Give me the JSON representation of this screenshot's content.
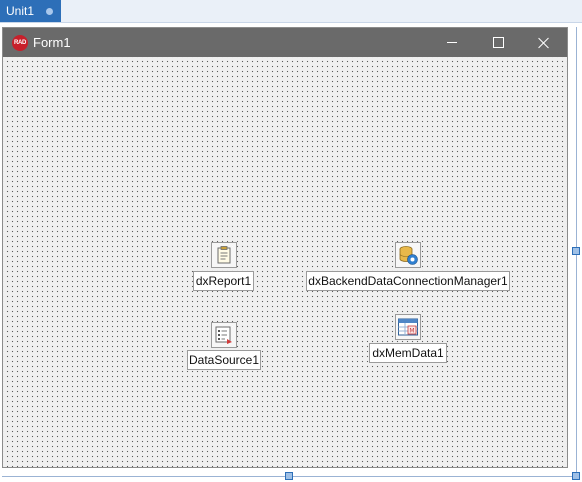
{
  "tab": {
    "label": "Unit1"
  },
  "form": {
    "title": "Form1",
    "icon_text": "RAD"
  },
  "components": [
    {
      "name": "dxReport1",
      "icon": "report-icon"
    },
    {
      "name": "dxBackendDataConnectionManager1",
      "icon": "database-gear-icon"
    },
    {
      "name": "DataSource1",
      "icon": "datasource-icon"
    },
    {
      "name": "dxMemData1",
      "icon": "memdata-table-icon"
    }
  ],
  "colors": {
    "tab_active": "#2d6fb8",
    "titlebar": "#6a6a6a",
    "rad_logo": "#c8202b"
  }
}
